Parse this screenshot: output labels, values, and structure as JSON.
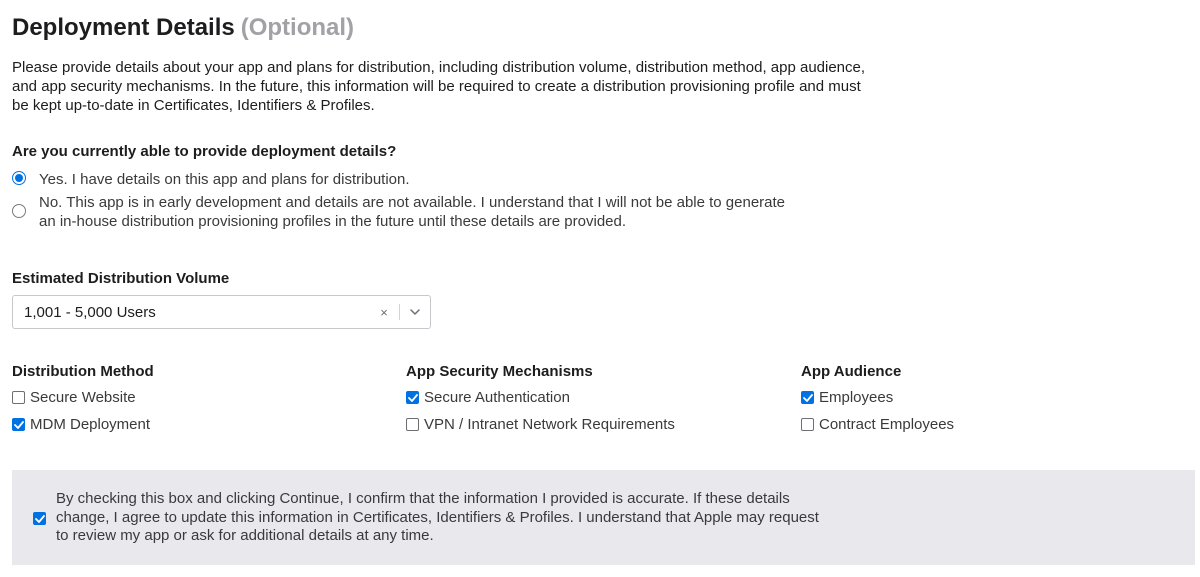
{
  "header": {
    "title": "Deployment Details",
    "optional": "(Optional)"
  },
  "intro": "Please provide details about your app and plans for distribution, including distribution volume, distribution method, app audience, and app security mechanisms. In the future, this information will be required to create a distribution provisioning profile and must be kept up-to-date in Certificates, Identifiers & Profiles.",
  "question": {
    "label": "Are you currently able to provide deployment details?",
    "options": [
      {
        "label": "Yes. I have details on this app and plans for distribution.",
        "selected": true
      },
      {
        "label": "No. This app is in early development and details are not available. I understand that I will not be able to generate an in-house distribution provisioning profiles in the future until these details are provided.",
        "selected": false
      }
    ]
  },
  "volume": {
    "label": "Estimated Distribution Volume",
    "value": "1,001 - 5,000 Users",
    "clear_glyph": "×"
  },
  "distribution_method": {
    "title": "Distribution Method",
    "options": [
      {
        "label": "Secure Website",
        "checked": false
      },
      {
        "label": "MDM Deployment",
        "checked": true
      }
    ]
  },
  "security": {
    "title": "App Security Mechanisms",
    "options": [
      {
        "label": "Secure Authentication",
        "checked": true
      },
      {
        "label": "VPN / Intranet Network Requirements",
        "checked": false
      }
    ]
  },
  "audience": {
    "title": "App Audience",
    "options": [
      {
        "label": "Employees",
        "checked": true
      },
      {
        "label": "Contract Employees",
        "checked": false
      }
    ]
  },
  "consent": {
    "text": "By checking this box and clicking Continue, I confirm that the information I provided is accurate. If these details change, I agree to update this information in Certificates, Identifiers & Profiles. I understand that Apple may request to review my app or ask for additional details at any time.",
    "checked": true
  },
  "colors": {
    "accent": "#0071e3",
    "consent_background": "#e8e8ed",
    "muted": "#a1a1a6"
  }
}
